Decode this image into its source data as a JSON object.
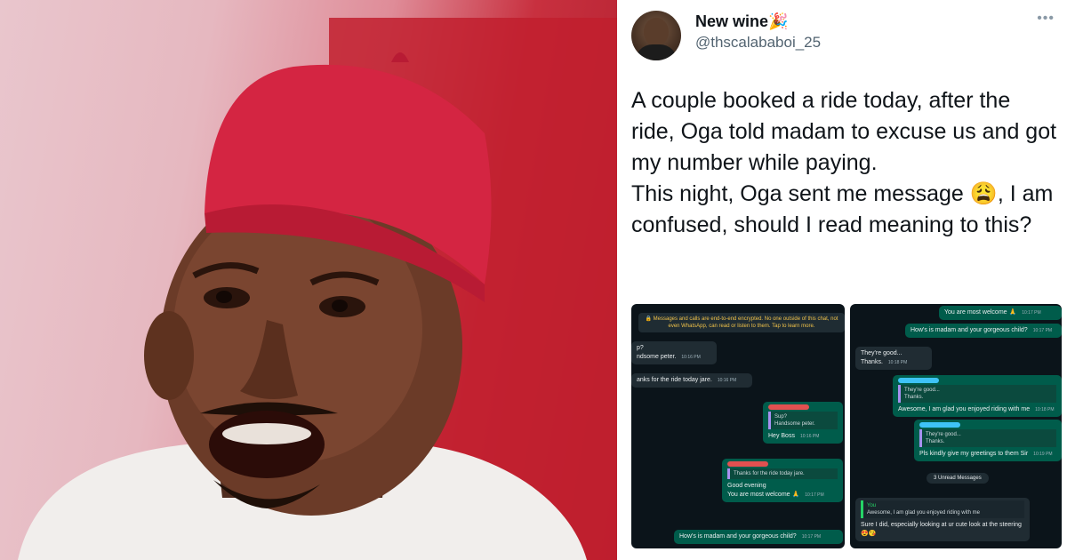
{
  "tweet": {
    "display_name": "New wine🎉",
    "handle": "@thscalababoi_25",
    "more_icon": "more-icon",
    "paragraphs": [
      "A couple booked a ride today, after the ride, Oga told madam to excuse us and got my number while paying.",
      "This night, Oga sent me message 😩, I am confused, should I read meaning to this?"
    ]
  },
  "screenshot_left": {
    "encryption_notice": "🔒 Messages and calls are end-to-end encrypted. No one outside of this chat, not even WhatsApp, can read or listen to them. Tap to learn more.",
    "messages": [
      {
        "text": "p?\nndsome peter.",
        "time": "10:16 PM",
        "side": "in"
      },
      {
        "text": "anks for the ride today jare.",
        "time": "10:16 PM",
        "side": "in"
      },
      {
        "quote": "Sup?\nHandsome peter.",
        "text": "Hey Boss",
        "time": "10:16 PM",
        "side": "out"
      },
      {
        "quote": "Thanks for the ride today jare.",
        "text": "Good evening\nYou are most welcome 🙏",
        "time": "10:17 PM",
        "side": "out"
      },
      {
        "text": "How's is madam and your gorgeous child?",
        "time": "10:17 PM",
        "side": "out"
      }
    ]
  },
  "screenshot_right": {
    "messages": [
      {
        "text": "You are most welcome 🙏",
        "time": "10:17 PM",
        "side": "out"
      },
      {
        "text": "How's is madam and your gorgeous child?",
        "time": "10:17 PM",
        "side": "out"
      },
      {
        "text": "They're good...\nThanks.",
        "time": "10:18 PM",
        "side": "in"
      },
      {
        "quote": "They're good...\nThanks.",
        "text": "Awesome, I am glad you enjoyed riding with me",
        "time": "10:18 PM",
        "side": "out"
      },
      {
        "quote": "They're good...\nThanks.",
        "text": "Pls kindly give my greetings to them Sir",
        "time": "10:19 PM",
        "side": "out"
      }
    ],
    "unread_label": "3 Unread Messages",
    "last_message": {
      "quote_author": "You",
      "quote": "Awesome, I am glad you enjoyed riding with me",
      "text": "Sure I did, especially looking at ur cute look at the steering😍😘"
    }
  }
}
